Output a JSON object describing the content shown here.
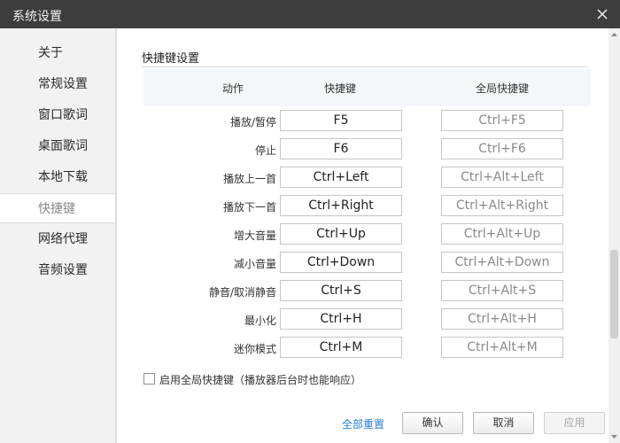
{
  "window": {
    "title": "系统设置"
  },
  "sidebar": {
    "items": [
      {
        "label": "关于"
      },
      {
        "label": "常规设置"
      },
      {
        "label": "窗口歌词"
      },
      {
        "label": "桌面歌词"
      },
      {
        "label": "本地下载"
      },
      {
        "label": "快捷键",
        "active": true
      },
      {
        "label": "网络代理"
      },
      {
        "label": "音频设置"
      }
    ]
  },
  "main": {
    "section_title": "快捷键设置",
    "headers": {
      "action": "动作",
      "hotkey": "快捷键",
      "global_hotkey": "全局快捷键"
    },
    "rows": [
      {
        "action": "播放/暂停",
        "hotkey": "F5",
        "global": "Ctrl+F5"
      },
      {
        "action": "停止",
        "hotkey": "F6",
        "global": "Ctrl+F6"
      },
      {
        "action": "播放上一首",
        "hotkey": "Ctrl+Left",
        "global": "Ctrl+Alt+Left"
      },
      {
        "action": "播放下一首",
        "hotkey": "Ctrl+Right",
        "global": "Ctrl+Alt+Right"
      },
      {
        "action": "增大音量",
        "hotkey": "Ctrl+Up",
        "global": "Ctrl+Alt+Up"
      },
      {
        "action": "减小音量",
        "hotkey": "Ctrl+Down",
        "global": "Ctrl+Alt+Down"
      },
      {
        "action": "静音/取消静音",
        "hotkey": "Ctrl+S",
        "global": "Ctrl+Alt+S"
      },
      {
        "action": "最小化",
        "hotkey": "Ctrl+H",
        "global": "Ctrl+Alt+H"
      },
      {
        "action": "迷你模式",
        "hotkey": "Ctrl+M",
        "global": "Ctrl+Alt+M"
      }
    ],
    "enable_global": {
      "label": "启用全局快捷键（播放器后台时也能响应）",
      "checked": false
    }
  },
  "footer": {
    "reset_label": "全部重置",
    "ok_label": "确认",
    "cancel_label": "取消",
    "apply_label": "应用",
    "apply_enabled": false
  },
  "colors": {
    "titlebar": "#3d3d3d",
    "link": "#2a7fd4",
    "active_item_text": "#8a8a8a"
  }
}
